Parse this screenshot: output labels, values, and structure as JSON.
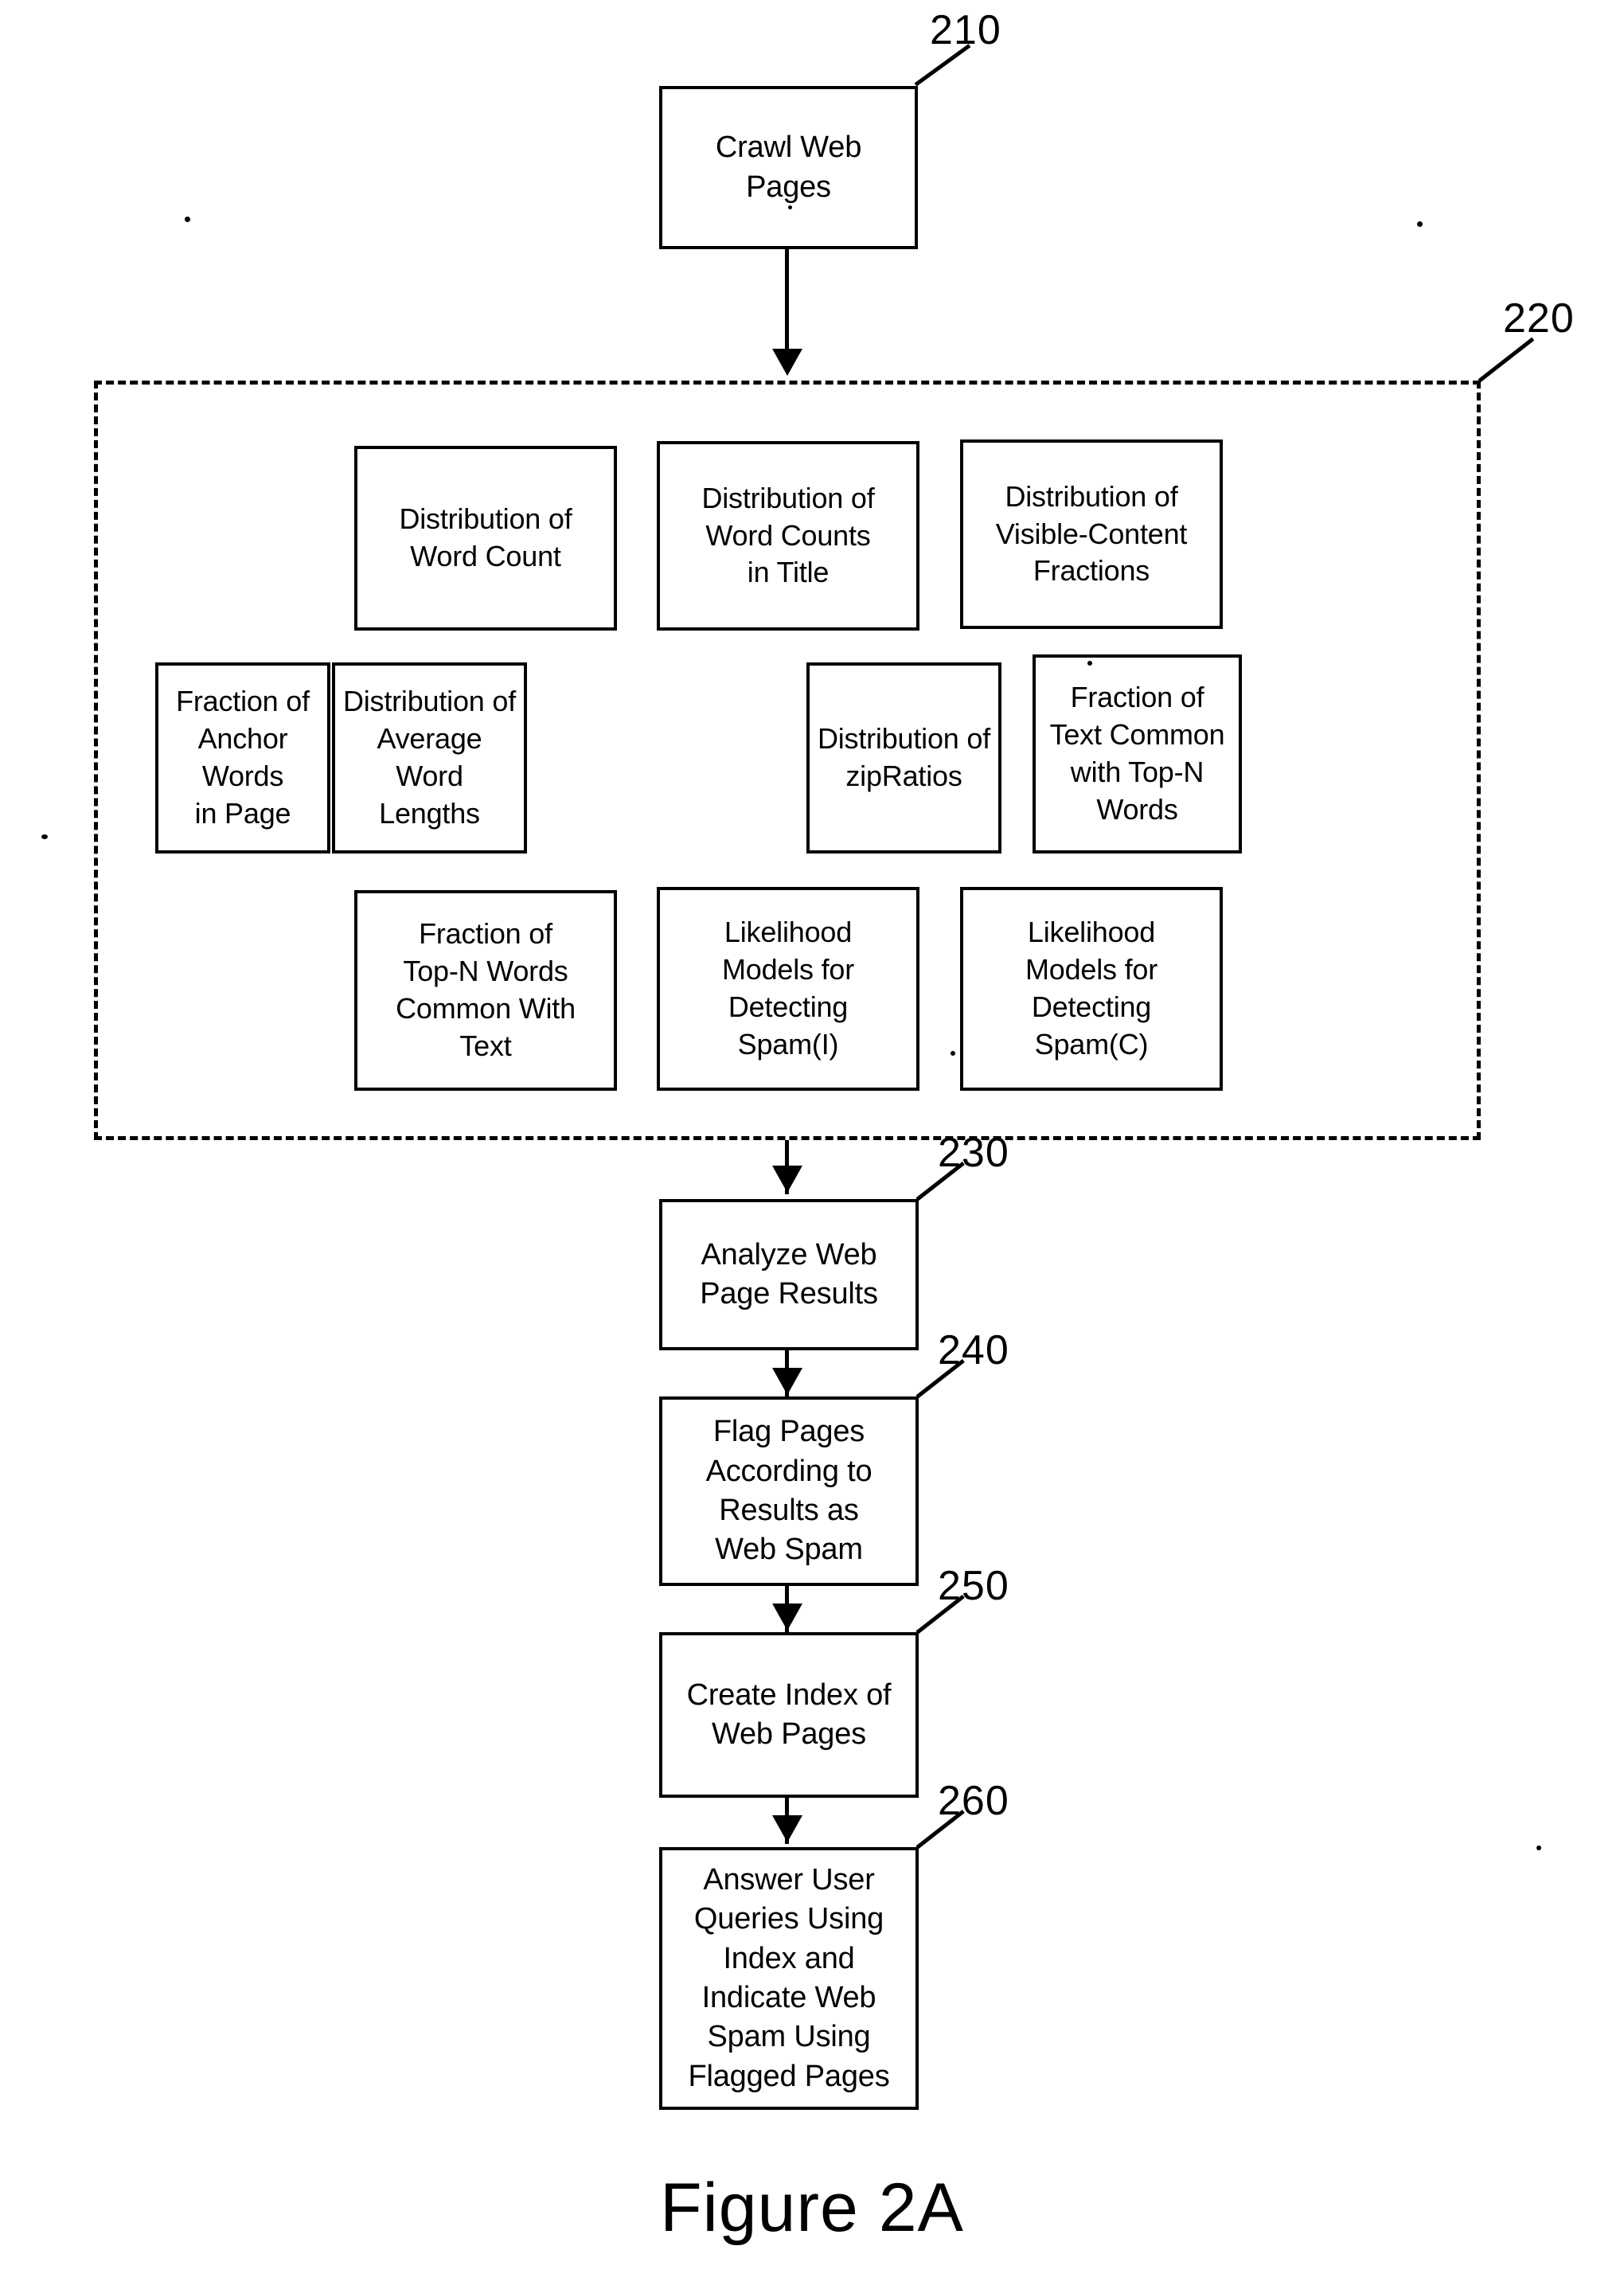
{
  "figure": {
    "caption": "Figure 2A"
  },
  "flow": {
    "start": {
      "ref": "210",
      "label": "Crawl Web\nPages"
    },
    "feature_group": {
      "ref": "220",
      "rows": [
        [
          {
            "label": "Distribution of\nWord Count"
          },
          {
            "label": "Distribution of\nWord Counts\nin Title"
          },
          {
            "label": "Distribution of\nVisible-Content\nFractions"
          }
        ],
        [
          {
            "label": "Fraction of\nAnchor Words\nin Page"
          },
          {
            "label": "Distribution of\nAverage Word\nLengths"
          },
          {
            "label": "Distribution of\nzipRatios"
          },
          {
            "label": "Fraction of\nText Common\nwith Top-N\nWords"
          }
        ],
        [
          {
            "label": "Fraction of\nTop-N Words\nCommon With\nText"
          },
          {
            "label": "Likelihood\nModels for\nDetecting\nSpam(I)"
          },
          {
            "label": "Likelihood\nModels for\nDetecting\nSpam(C)"
          }
        ]
      ]
    },
    "steps": [
      {
        "ref": "230",
        "label": "Analyze Web\nPage Results"
      },
      {
        "ref": "240",
        "label": "Flag Pages\nAccording to\nResults as\nWeb Spam"
      },
      {
        "ref": "250",
        "label": "Create Index of\nWeb Pages"
      },
      {
        "ref": "260",
        "label": "Answer User\nQueries Using\nIndex and\nIndicate Web\nSpam Using\nFlagged Pages"
      }
    ]
  },
  "colors": {
    "ink": "#000000",
    "paper": "#ffffff"
  }
}
